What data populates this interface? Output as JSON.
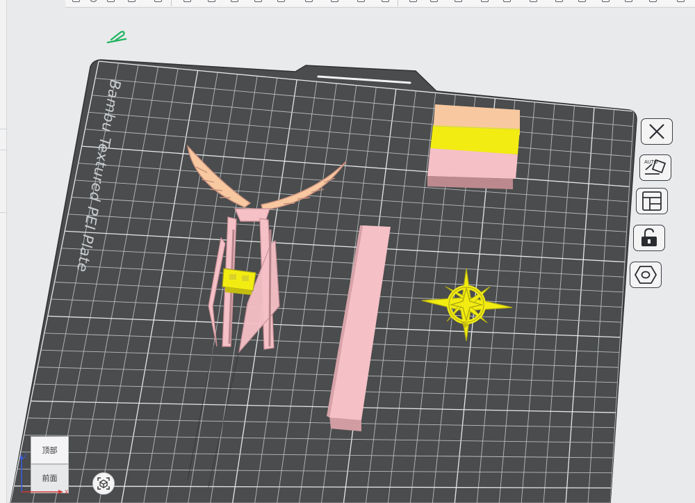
{
  "plate": {
    "name": "Bambu Textured PEI Plate"
  },
  "view_cube": {
    "top_label": "顶部",
    "front_label": "前面",
    "axis_x": "X",
    "axis_z": "Z"
  },
  "side_toolbar": {
    "buttons": [
      "close",
      "auto-orient",
      "arrange",
      "lock",
      "settings"
    ],
    "auto_label": "AUTO"
  },
  "colors": {
    "plate_bg": "#4a4c4d",
    "grid_line": "#dadcdd",
    "pink": "#f5c0c6",
    "peach": "#f8c8a0",
    "yellow": "#f2ec12",
    "edit_icon": "#1fb45f"
  }
}
